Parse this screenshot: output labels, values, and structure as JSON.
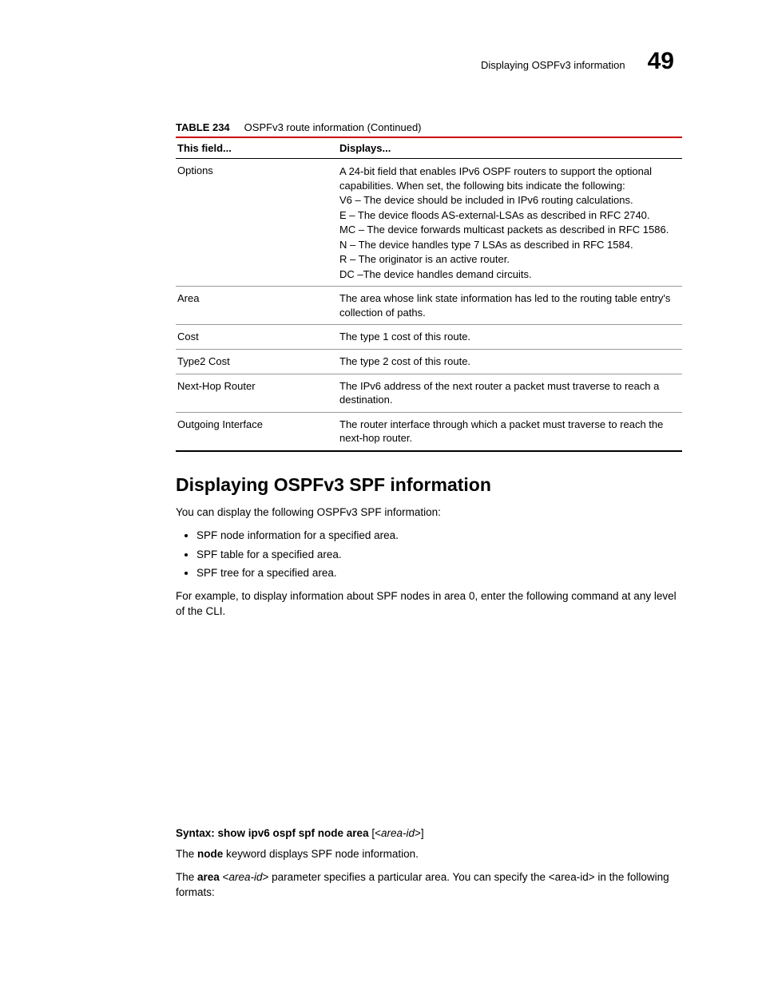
{
  "header": {
    "title": "Displaying OSPFv3 information",
    "chapter": "49"
  },
  "table": {
    "number": "TABLE 234",
    "title": "OSPFv3 route information  (Continued)",
    "col1": "This field...",
    "col2": "Displays...",
    "rows": {
      "r0": {
        "field": "Options",
        "line0": "A 24-bit field that enables IPv6 OSPF routers to support the optional capabilities. When set, the following bits indicate the following:",
        "line1": "V6 – The device should be included in IPv6 routing calculations.",
        "line2": "E – The device floods AS-external-LSAs as described in RFC 2740.",
        "line3": "MC – The device forwards multicast packets as described in RFC 1586.",
        "line4": "N – The device handles type 7 LSAs as described in RFC 1584.",
        "line5": "R – The originator is an active router.",
        "line6": "DC –The device handles demand circuits."
      },
      "r1": {
        "field": "Area",
        "desc": "The area whose link state information has led to the routing table entry's collection of paths."
      },
      "r2": {
        "field": "Cost",
        "desc": "The type 1 cost of this route."
      },
      "r3": {
        "field": "Type2 Cost",
        "desc": "The type 2 cost of this route."
      },
      "r4": {
        "field": "Next-Hop Router",
        "desc": "The IPv6 address of the next router a packet must traverse to reach a destination."
      },
      "r5": {
        "field": "Outgoing Interface",
        "desc": "The router interface through which a packet must traverse to reach the next-hop router."
      }
    }
  },
  "section": {
    "heading": "Displaying OSPFv3 SPF information",
    "intro": "You can display the following OSPFv3 SPF information:",
    "b0": "SPF node information for a specified area.",
    "b1": "SPF table for a specified area.",
    "b2": "SPF tree for a specified area.",
    "example": "For example, to display information about SPF nodes in area 0, enter the following command at any level of the CLI."
  },
  "syntax": {
    "label": "Syntax:",
    "cmd": " show ipv6 ospf spf node area ",
    "bracket_open": "[<",
    "param": "area-id",
    "bracket_close": ">]"
  },
  "para1": {
    "pre": "The ",
    "bold": "node",
    "post": " keyword displays SPF node information."
  },
  "para2": {
    "pre": "The ",
    "bold": "area",
    "mid": " <",
    "ital": "area-id",
    "post": "> parameter specifies a particular area. You can specify the <area-id> in the following formats:"
  }
}
